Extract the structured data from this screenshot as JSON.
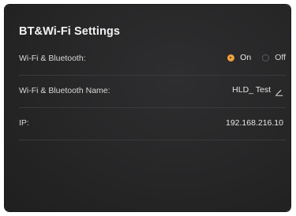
{
  "panel": {
    "title": "BT&Wi-Fi Settings"
  },
  "rows": {
    "wifi_bt": {
      "label": "Wi-Fi & Bluetooth:",
      "options": [
        {
          "label": "On",
          "selected": true
        },
        {
          "label": "Off",
          "selected": false
        }
      ]
    },
    "name": {
      "label": "Wi-Fi & Bluetooth Name:",
      "value": "HLD_ Test",
      "icon": "edit-pencil-icon"
    },
    "ip": {
      "label": "IP:",
      "value": "192.168.216.10"
    }
  },
  "colors": {
    "accent": "#f0a23a",
    "panel_bg": "#2a2a2b",
    "text": "#e6e6e6"
  }
}
